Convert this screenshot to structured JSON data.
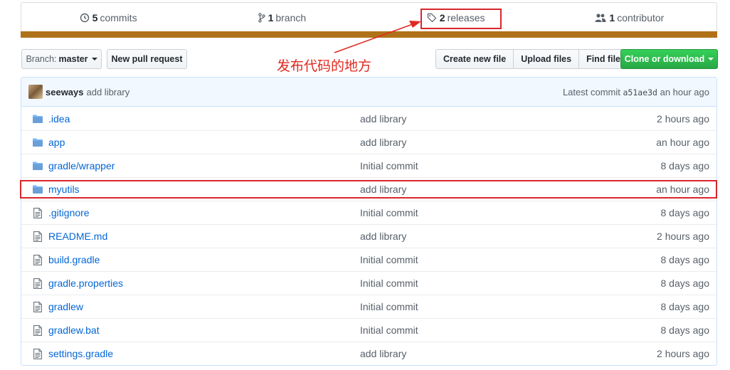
{
  "stats": {
    "commits": {
      "num": "5",
      "label": "commits",
      "icon": "history-icon"
    },
    "branches": {
      "num": "1",
      "label": "branch",
      "icon": "branch-icon"
    },
    "releases": {
      "num": "2",
      "label": "releases",
      "icon": "tag-icon"
    },
    "contributors": {
      "num": "1",
      "label": "contributor",
      "icon": "people-icon"
    },
    "language_color": "#b07219"
  },
  "annotation": {
    "text": "发布代码的地方",
    "color": "#e0281f"
  },
  "toolbar": {
    "branch_prefix": "Branch:",
    "branch_name": "master",
    "new_pr": "New pull request",
    "create_file": "Create new file",
    "upload_files": "Upload files",
    "find_file": "Find file",
    "clone": "Clone or download"
  },
  "commit": {
    "author": "seeways",
    "message": "add library",
    "latest_label": "Latest commit",
    "sha": "a51ae3d",
    "age": "an hour ago"
  },
  "files": [
    {
      "name": ".idea",
      "type": "folder",
      "message": "add library",
      "age": "2 hours ago"
    },
    {
      "name": "app",
      "type": "folder",
      "message": "add library",
      "age": "an hour ago"
    },
    {
      "name": "gradle/wrapper",
      "type": "folder",
      "message": "Initial commit",
      "age": "8 days ago"
    },
    {
      "name": "myutils",
      "type": "folder",
      "message": "add library",
      "age": "an hour ago"
    },
    {
      "name": ".gitignore",
      "type": "file",
      "message": "Initial commit",
      "age": "8 days ago"
    },
    {
      "name": "README.md",
      "type": "file",
      "message": "add library",
      "age": "2 hours ago"
    },
    {
      "name": "build.gradle",
      "type": "file",
      "message": "Initial commit",
      "age": "8 days ago"
    },
    {
      "name": "gradle.properties",
      "type": "file",
      "message": "Initial commit",
      "age": "8 days ago"
    },
    {
      "name": "gradlew",
      "type": "file",
      "message": "Initial commit",
      "age": "8 days ago"
    },
    {
      "name": "gradlew.bat",
      "type": "file",
      "message": "Initial commit",
      "age": "8 days ago"
    },
    {
      "name": "settings.gradle",
      "type": "file",
      "message": "add library",
      "age": "2 hours ago"
    }
  ]
}
